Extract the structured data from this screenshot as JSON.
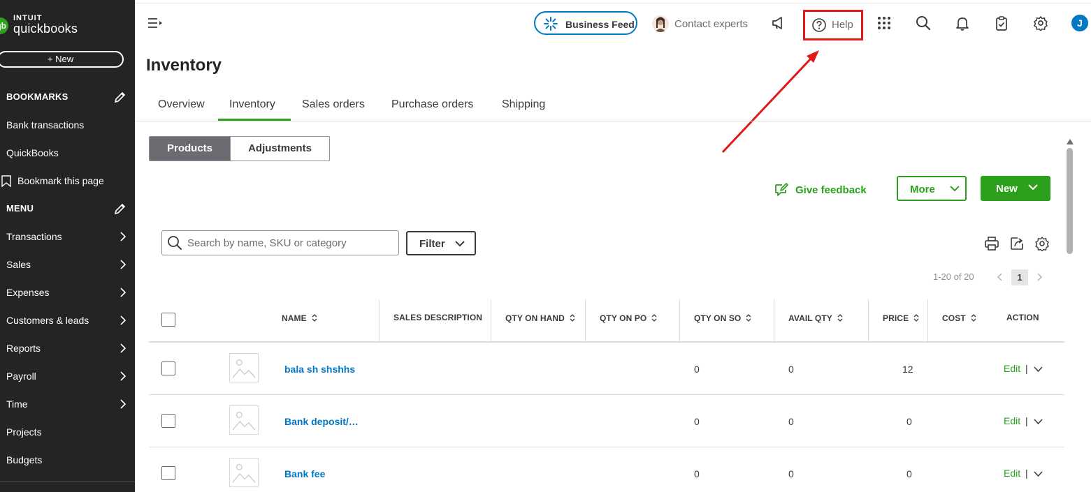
{
  "brand": {
    "badge": "qb",
    "intuit": "INTUIT",
    "product": "quickbooks"
  },
  "sidebar": {
    "new_label": "+  New",
    "bookmarks_title": "BOOKMARKS",
    "bookmarks": [
      "Bank transactions",
      "QuickBooks"
    ],
    "bookmark_this_page": "Bookmark this page",
    "menu_title": "MENU",
    "menu": [
      {
        "label": "Transactions",
        "has_arrow": true
      },
      {
        "label": "Sales",
        "has_arrow": true
      },
      {
        "label": "Expenses",
        "has_arrow": true
      },
      {
        "label": "Customers & leads",
        "has_arrow": true
      },
      {
        "label": "Reports",
        "has_arrow": true
      },
      {
        "label": "Payroll",
        "has_arrow": true
      },
      {
        "label": "Time",
        "has_arrow": true
      },
      {
        "label": "Projects",
        "has_arrow": false
      },
      {
        "label": "Budgets",
        "has_arrow": false
      }
    ]
  },
  "topbar": {
    "business_feed": "Business Feed",
    "contact_experts": "Contact experts",
    "help": "Help",
    "user_initial": "J",
    "icons": [
      "megaphone-icon",
      "apps-grid-icon",
      "search-icon",
      "bell-icon",
      "clipboard-icon",
      "gear-icon"
    ]
  },
  "page": {
    "title": "Inventory",
    "tabs": [
      "Overview",
      "Inventory",
      "Sales orders",
      "Purchase orders",
      "Shipping"
    ],
    "active_tab": "Inventory"
  },
  "segment": {
    "products": "Products",
    "adjustments": "Adjustments"
  },
  "actions": {
    "give_feedback": "Give feedback",
    "more": "More",
    "new": "New"
  },
  "search": {
    "placeholder": "Search by name, SKU or category",
    "value": ""
  },
  "filter_label": "Filter",
  "pagination": {
    "range": "1-20 of 20",
    "current": "1"
  },
  "table": {
    "columns": [
      "NAME",
      "SALES DESCRIPTION",
      "QTY ON HAND",
      "QTY ON PO",
      "QTY ON SO",
      "AVAIL QTY",
      "PRICE",
      "COST",
      "ACTION"
    ],
    "rows": [
      {
        "name": "bala sh shshhs",
        "qty_on_so": "0",
        "avail_qty": "0",
        "price": "12",
        "action": "Edit"
      },
      {
        "name": "Bank deposit/…",
        "qty_on_so": "0",
        "avail_qty": "0",
        "price": "0",
        "action": "Edit"
      },
      {
        "name": "Bank fee",
        "qty_on_so": "0",
        "avail_qty": "0",
        "price": "0",
        "action": "Edit"
      }
    ]
  },
  "colors": {
    "brand_green": "#2ca01c",
    "link_blue": "#0077c5",
    "sidebar_bg": "#242424",
    "annotation_red": "#e0191a"
  }
}
